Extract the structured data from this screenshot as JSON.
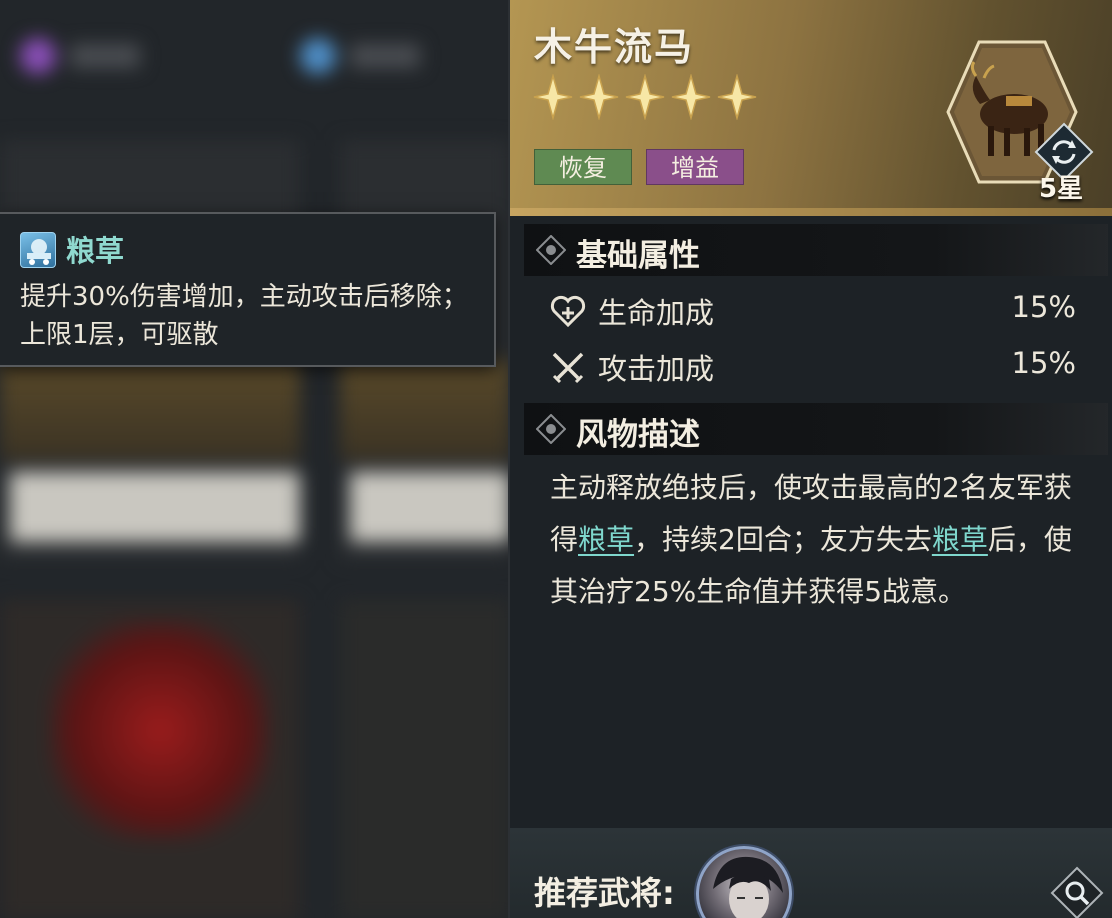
{
  "tooltip": {
    "icon": "forage-cart-icon",
    "title": "粮草",
    "description": "提升30%伤害增加，主动攻击后移除；上限1层，可驱散"
  },
  "item": {
    "name": "木牛流马",
    "stars": 5,
    "tags": [
      "恢复",
      "增益"
    ],
    "rank": "5星",
    "portrait_icon": "wooden-ox-icon"
  },
  "base_attributes": {
    "title": "基础属性",
    "rows": [
      {
        "icon": "heart-plus-icon",
        "label": "生命加成",
        "value": "15%"
      },
      {
        "icon": "crossed-swords-icon",
        "label": "攻击加成",
        "value": "15%"
      }
    ]
  },
  "description_section": {
    "title": "风物描述",
    "segments": [
      {
        "text": "主动释放绝技后，使攻击最高的2名友军获得",
        "link": false
      },
      {
        "text": "粮草",
        "link": true
      },
      {
        "text": "，持续2回合；友方失去",
        "link": false
      },
      {
        "text": "粮草",
        "link": true
      },
      {
        "text": "后，使其治疗25%生命值并获得5战意。",
        "link": false
      }
    ]
  },
  "footer": {
    "label": "推荐武将:",
    "search_icon": "magnifier-icon"
  },
  "colors": {
    "accent_link": "#7fd7cd",
    "tag_green": "#5f8a52",
    "tag_purple": "#8a4f8a",
    "header_gold": "#b49652"
  }
}
